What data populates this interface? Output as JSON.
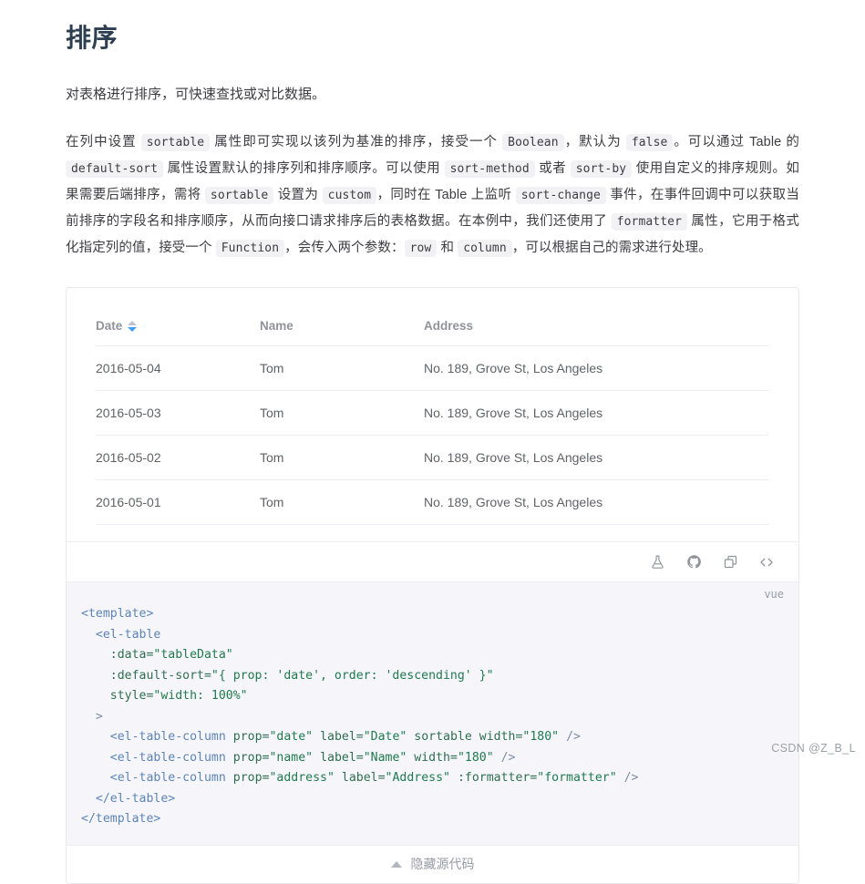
{
  "page": {
    "title": "排序",
    "intro": "对表格进行排序，可快速查找或对比数据。"
  },
  "description": {
    "segments": [
      {
        "type": "text",
        "value": "在列中设置 "
      },
      {
        "type": "code",
        "value": "sortable"
      },
      {
        "type": "text",
        "value": " 属性即可实现以该列为基准的排序，接受一个 "
      },
      {
        "type": "code",
        "value": "Boolean"
      },
      {
        "type": "text",
        "value": "，默认为 "
      },
      {
        "type": "code",
        "value": "false"
      },
      {
        "type": "text",
        "value": "。可以通过 Table 的 "
      },
      {
        "type": "code",
        "value": "default-sort"
      },
      {
        "type": "text",
        "value": " 属性设置默认的排序列和排序顺序。可以使用 "
      },
      {
        "type": "code",
        "value": "sort-method"
      },
      {
        "type": "text",
        "value": " 或者 "
      },
      {
        "type": "code",
        "value": "sort-by"
      },
      {
        "type": "text",
        "value": " 使用自定义的排序规则。如果需要后端排序，需将 "
      },
      {
        "type": "code",
        "value": "sortable"
      },
      {
        "type": "text",
        "value": " 设置为 "
      },
      {
        "type": "code",
        "value": "custom"
      },
      {
        "type": "text",
        "value": "，同时在 Table 上监听 "
      },
      {
        "type": "code",
        "value": "sort-change"
      },
      {
        "type": "text",
        "value": " 事件，在事件回调中可以获取当前排序的字段名和排序顺序，从而向接口请求排序后的表格数据。在本例中，我们还使用了 "
      },
      {
        "type": "code",
        "value": "formatter"
      },
      {
        "type": "text",
        "value": " 属性，它用于格式化指定列的值，接受一个 "
      },
      {
        "type": "code",
        "value": "Function"
      },
      {
        "type": "text",
        "value": "，会传入两个参数："
      },
      {
        "type": "code",
        "value": "row"
      },
      {
        "type": "text",
        "value": " 和 "
      },
      {
        "type": "code",
        "value": "column"
      },
      {
        "type": "text",
        "value": "，可以根据自己的需求进行处理。"
      }
    ]
  },
  "table": {
    "columns": [
      {
        "label": "Date",
        "sortable": true,
        "sort_order": "descending",
        "width": "180"
      },
      {
        "label": "Name",
        "sortable": false,
        "width": "180"
      },
      {
        "label": "Address",
        "sortable": false
      }
    ],
    "rows": [
      {
        "date": "2016-05-04",
        "name": "Tom",
        "address": "No. 189, Grove St, Los Angeles"
      },
      {
        "date": "2016-05-03",
        "name": "Tom",
        "address": "No. 189, Grove St, Los Angeles"
      },
      {
        "date": "2016-05-02",
        "name": "Tom",
        "address": "No. 189, Grove St, Los Angeles"
      },
      {
        "date": "2016-05-01",
        "name": "Tom",
        "address": "No. 189, Grove St, Los Angeles"
      }
    ]
  },
  "toolbar": {
    "icons": [
      {
        "name": "playground-flask-icon",
        "title": "在 Playground 中编辑"
      },
      {
        "name": "github-icon",
        "title": "在 GitHub 中查看"
      },
      {
        "name": "copy-icon",
        "title": "复制代码"
      },
      {
        "name": "code-brackets-icon",
        "title": "查看源代码"
      }
    ]
  },
  "code_block": {
    "language": "vue",
    "lines": [
      [
        {
          "t": "tag",
          "v": "<template>"
        }
      ],
      [
        {
          "t": "text",
          "v": "  "
        },
        {
          "t": "tag",
          "v": "<el-table"
        }
      ],
      [
        {
          "t": "text",
          "v": "    "
        },
        {
          "t": "attr",
          "v": ":data="
        },
        {
          "t": "str",
          "v": "\"tableData\""
        }
      ],
      [
        {
          "t": "text",
          "v": "    "
        },
        {
          "t": "attr",
          "v": ":default-sort="
        },
        {
          "t": "str",
          "v": "\"{ prop: 'date', order: 'descending' }\""
        }
      ],
      [
        {
          "t": "text",
          "v": "    "
        },
        {
          "t": "attr",
          "v": "style="
        },
        {
          "t": "str",
          "v": "\"width: 100%\""
        }
      ],
      [
        {
          "t": "text",
          "v": "  "
        },
        {
          "t": "tag2",
          "v": ">"
        }
      ],
      [
        {
          "t": "text",
          "v": "    "
        },
        {
          "t": "tag",
          "v": "<el-table-column"
        },
        {
          "t": "text",
          "v": " "
        },
        {
          "t": "attr",
          "v": "prop="
        },
        {
          "t": "str",
          "v": "\"date\""
        },
        {
          "t": "text",
          "v": " "
        },
        {
          "t": "attr",
          "v": "label="
        },
        {
          "t": "str",
          "v": "\"Date\""
        },
        {
          "t": "text",
          "v": " "
        },
        {
          "t": "attr",
          "v": "sortable"
        },
        {
          "t": "text",
          "v": " "
        },
        {
          "t": "attr",
          "v": "width="
        },
        {
          "t": "str",
          "v": "\"180\""
        },
        {
          "t": "text",
          "v": " "
        },
        {
          "t": "tag2",
          "v": "/>"
        }
      ],
      [
        {
          "t": "text",
          "v": "    "
        },
        {
          "t": "tag",
          "v": "<el-table-column"
        },
        {
          "t": "text",
          "v": " "
        },
        {
          "t": "attr",
          "v": "prop="
        },
        {
          "t": "str",
          "v": "\"name\""
        },
        {
          "t": "text",
          "v": " "
        },
        {
          "t": "attr",
          "v": "label="
        },
        {
          "t": "str",
          "v": "\"Name\""
        },
        {
          "t": "text",
          "v": " "
        },
        {
          "t": "attr",
          "v": "width="
        },
        {
          "t": "str",
          "v": "\"180\""
        },
        {
          "t": "text",
          "v": " "
        },
        {
          "t": "tag2",
          "v": "/>"
        }
      ],
      [
        {
          "t": "text",
          "v": "    "
        },
        {
          "t": "tag",
          "v": "<el-table-column"
        },
        {
          "t": "text",
          "v": " "
        },
        {
          "t": "attr",
          "v": "prop="
        },
        {
          "t": "str",
          "v": "\"address\""
        },
        {
          "t": "text",
          "v": " "
        },
        {
          "t": "attr",
          "v": "label="
        },
        {
          "t": "str",
          "v": "\"Address\""
        },
        {
          "t": "text",
          "v": " "
        },
        {
          "t": "attr",
          "v": ":formatter="
        },
        {
          "t": "str",
          "v": "\"formatter\""
        },
        {
          "t": "text",
          "v": " "
        },
        {
          "t": "tag2",
          "v": "/>"
        }
      ],
      [
        {
          "t": "text",
          "v": "  "
        },
        {
          "t": "tag",
          "v": "</el-table>"
        }
      ],
      [
        {
          "t": "tag",
          "v": "</template>"
        }
      ]
    ]
  },
  "hide_source": {
    "label": "隐藏源代码",
    "icon": "caret-up-icon"
  },
  "watermark": "CSDN @Z_B_L",
  "colors": {
    "accent": "#409eff",
    "caret_inactive": "#c0c4cc",
    "header_text": "#909399",
    "code_bg": "#f6f6fa"
  }
}
